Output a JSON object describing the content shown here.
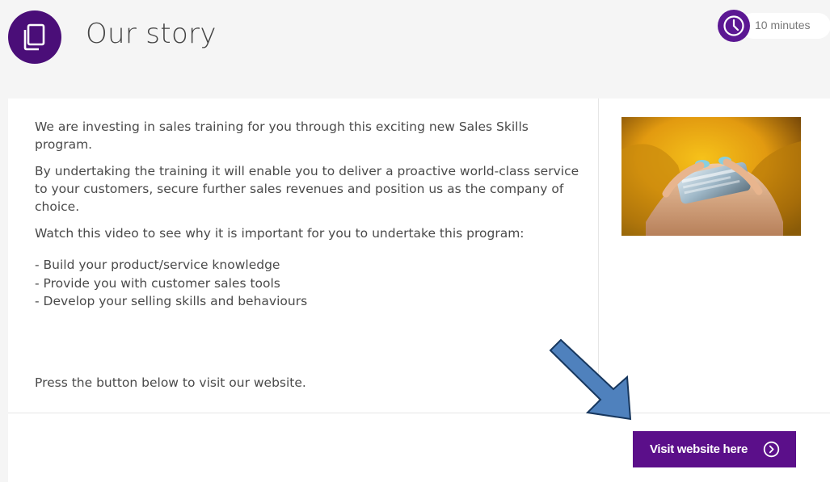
{
  "header": {
    "title": "Our story",
    "duration": "10 minutes"
  },
  "content": {
    "paragraphs": [
      "We are investing in sales training for you through this exciting new Sales Skills program.",
      "By undertaking the training it will enable you to deliver a proactive world-class service to your customers, secure further sales revenues and position us as the company of choice.",
      "Watch this video to see why it is important for you to undertake this program:"
    ],
    "bullets": [
      "- Build your product/service knowledge",
      "- Provide you with customer sales tools",
      "- Develop your selling skills and behaviours"
    ],
    "footer_text": "Press the button below to visit our website."
  },
  "button": {
    "label": "Visit website here",
    "icon": "chevron-circle-right-icon"
  },
  "icons": {
    "page": "pages-icon",
    "clock": "clock-icon",
    "annotation": "blue-arrow-pointer"
  },
  "colors": {
    "accent": "#5b0f8a",
    "icon_bg": "#4a0e78",
    "arrow_fill": "#4f81bd"
  }
}
